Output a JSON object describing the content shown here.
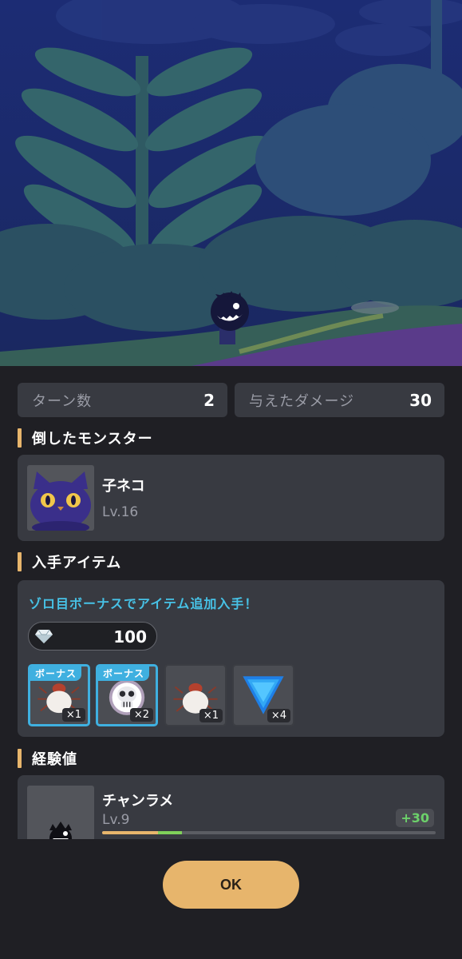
{
  "stats": {
    "turns_label": "ターン数",
    "turns_value": "2",
    "damage_label": "与えたダメージ",
    "damage_value": "30"
  },
  "defeated_section": {
    "title": "倒したモンスター",
    "monster": {
      "name": "子ネコ",
      "level": "Lv.16",
      "icon": "purple-cat-icon"
    }
  },
  "items_section": {
    "title": "入手アイテム",
    "bonus_message": "ゾロ目ボーナスでアイテム追加入手！",
    "gem": {
      "icon": "diamond-gem-icon",
      "count": "100"
    },
    "items": [
      {
        "icon": "tick-bug-icon",
        "quantity": "×1",
        "bonus": true,
        "bonus_label": "ボーナス"
      },
      {
        "icon": "skull-icon",
        "quantity": "×2",
        "bonus": true,
        "bonus_label": "ボーナス"
      },
      {
        "icon": "tick-bug-icon",
        "quantity": "×1",
        "bonus": false
      },
      {
        "icon": "blue-triangle-icon",
        "quantity": "×4",
        "bonus": false
      }
    ]
  },
  "exp_section": {
    "title": "経験値",
    "character": {
      "name": "チャンラメ",
      "level": "Lv.9",
      "exp_gain": "+30",
      "progress_fraction": 0.24,
      "icon": "spiky-black-creature-icon"
    }
  },
  "ok_button": {
    "label": "OK"
  },
  "colors": {
    "accent": "#e7b56c",
    "bonus_blue": "#3fb0e0",
    "exp_green": "#6cd16a",
    "panel_bg": "#1f1f24",
    "card_bg": "#383a41"
  }
}
